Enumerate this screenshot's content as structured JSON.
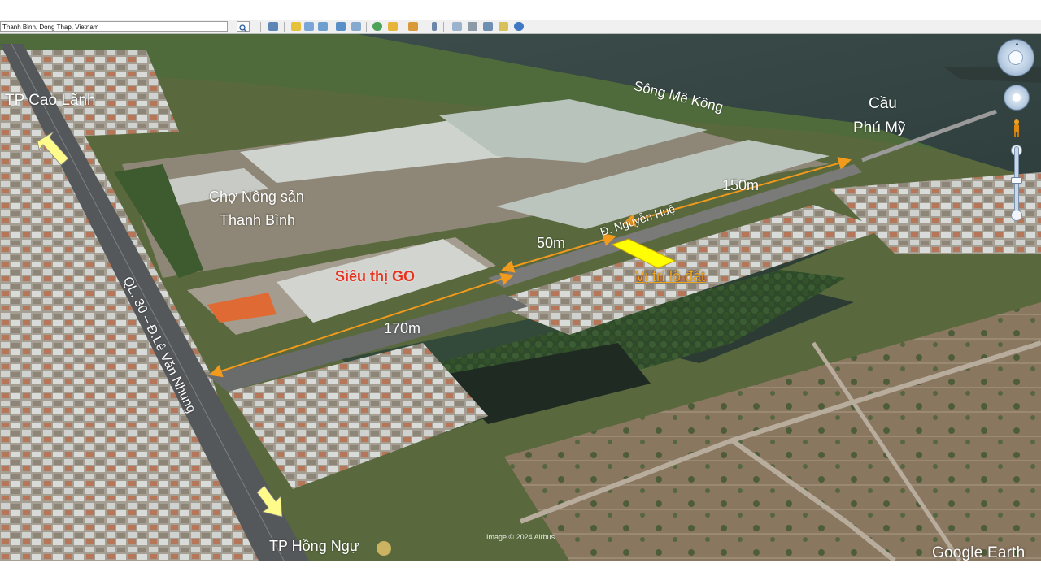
{
  "toolbar": {
    "search_value": "Thanh Binh, Dong Thap, Vietnam",
    "tools": [
      "search-icon",
      "sidebar-icon",
      "placemark-icon",
      "polygon-icon",
      "path-icon",
      "overlay-icon",
      "tour-icon",
      "history-icon",
      "sun-icon",
      "planet-icon",
      "ruler-icon",
      "email-icon",
      "print-icon",
      "save-image-icon",
      "maps-icon",
      "earth-icon"
    ]
  },
  "map": {
    "labels": {
      "cao_lanh": "TP Cao Lãnh",
      "hong_ngu": "TP Hồng Ngự",
      "river": "Sông Mê Kông",
      "bridge_line1": "Cầu",
      "bridge_line2": "Phú Mỹ",
      "market_line1": "Chợ Nông sản",
      "market_line2": "Thanh Bình",
      "supermarket": "Siêu thị GO",
      "highway": "QL. 30 – Đ.Lê Văn Nhung",
      "street": "Đ. Nguyễn Huệ",
      "dist_150": "150m",
      "dist_50": "50m",
      "dist_170": "170m",
      "lot": "Vị trí lô đất"
    },
    "imagery_credit": "Image © 2024 Airbus",
    "logo": "Google Earth"
  },
  "colors": {
    "highlight_lot": "#ffff00",
    "distance_arrow": "#f29a1c",
    "supermarket_text": "#e8321e",
    "lot_text": "#f2a31c",
    "direction_arrow": "#fffb8a"
  }
}
